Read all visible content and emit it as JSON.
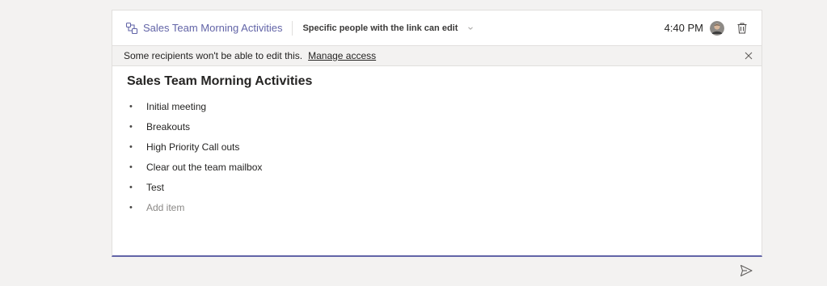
{
  "header": {
    "loop_title": "Sales Team Morning Activities",
    "share_permission": "Specific people with the link can edit",
    "time": "4:40 PM"
  },
  "banner": {
    "message": "Some recipients won't be able to edit this.",
    "manage_link": "Manage access"
  },
  "list": {
    "title": "Sales Team Morning Activities",
    "bullet": "•",
    "items": [
      {
        "label": "Initial meeting"
      },
      {
        "label": "Breakouts"
      },
      {
        "label": "High Priority Call outs"
      },
      {
        "label": "Clear out the team mailbox"
      },
      {
        "label": "Test"
      }
    ],
    "add_placeholder": "Add item"
  },
  "colors": {
    "accent": "#6264a7",
    "background": "#f3f2f1",
    "card": "#ffffff",
    "banner": "#f3f2f1"
  },
  "icons": {
    "loop": "loop-component-icon",
    "chevron": "chevron-down-icon",
    "avatar": "user-avatar",
    "trash": "trash-icon",
    "close": "close-icon",
    "send": "send-icon"
  }
}
